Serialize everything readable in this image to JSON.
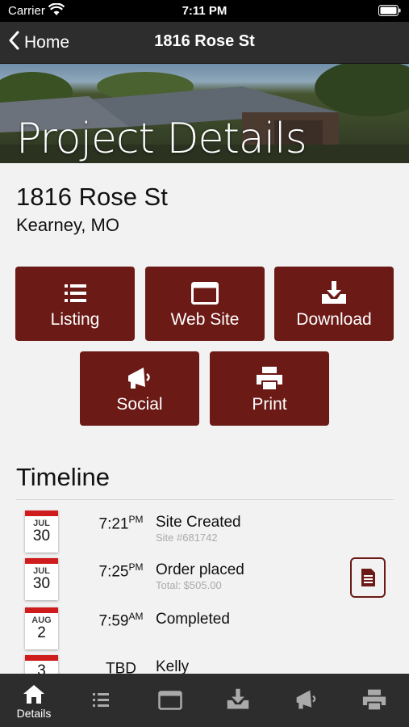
{
  "status_bar": {
    "carrier": "Carrier",
    "time": "7:11 PM"
  },
  "nav": {
    "back_label": "Home",
    "title": "1816 Rose St"
  },
  "hero": {
    "title": "Project Details"
  },
  "property": {
    "street": "1816 Rose St",
    "city_state": "Kearney, MO"
  },
  "actions": [
    {
      "label": "Listing",
      "icon": "list-icon"
    },
    {
      "label": "Web Site",
      "icon": "browser-window-icon"
    },
    {
      "label": "Download",
      "icon": "download-tray-icon"
    },
    {
      "label": "Social",
      "icon": "megaphone-icon"
    },
    {
      "label": "Print",
      "icon": "printer-icon"
    }
  ],
  "timeline": {
    "title": "Timeline",
    "events": [
      {
        "month": "JUL",
        "day": "30",
        "time": "7:21",
        "ampm": "PM",
        "title": "Site Created",
        "subtitle": "Site #681742"
      },
      {
        "month": "JUL",
        "day": "30",
        "time": "7:25",
        "ampm": "PM",
        "title": "Order placed",
        "subtitle": "Total: $505.00"
      },
      {
        "month": "AUG",
        "day": "2",
        "time": "7:59",
        "ampm": "AM",
        "title": "Completed",
        "subtitle": ""
      },
      {
        "month": "",
        "day": "3",
        "time": "TBD",
        "ampm": "",
        "title": "Kelly",
        "subtitle": ""
      }
    ]
  },
  "tab_bar": {
    "tabs": [
      {
        "label": "Details",
        "icon": "home-icon",
        "active": true
      },
      {
        "label": "",
        "icon": "list-icon"
      },
      {
        "label": "",
        "icon": "browser-window-icon"
      },
      {
        "label": "",
        "icon": "download-tray-icon"
      },
      {
        "label": "",
        "icon": "megaphone-icon"
      },
      {
        "label": "",
        "icon": "printer-icon"
      }
    ]
  },
  "colors": {
    "accent": "#6b1a16",
    "calendar_red": "#cf1d1d",
    "bar": "#2d2d2d"
  }
}
